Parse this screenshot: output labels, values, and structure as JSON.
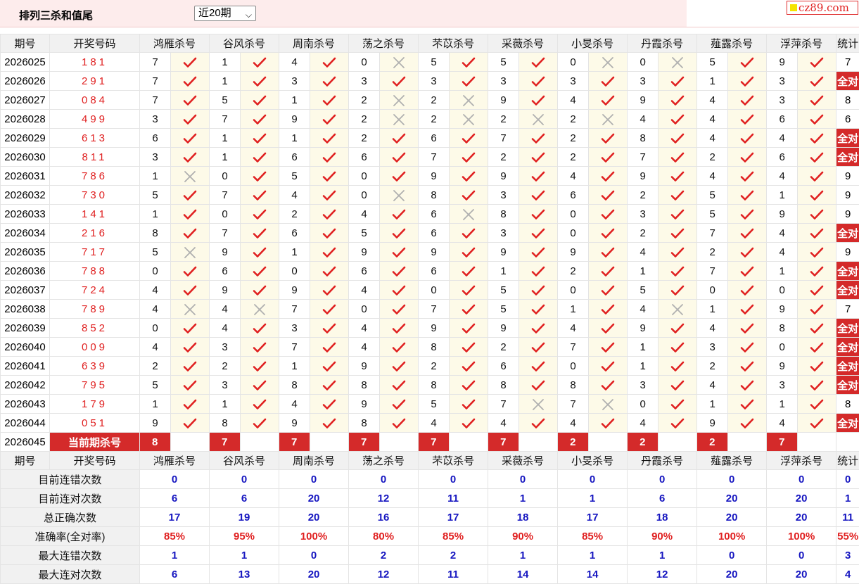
{
  "header": {
    "title": "排列三杀和值尾",
    "range_select": "近20期",
    "logo_text": "cz89.com"
  },
  "columns": {
    "period": "期号",
    "winning": "开奖号码",
    "experts": [
      "鸿雁杀号",
      "谷风杀号",
      "周南杀号",
      "荡之杀号",
      "芣苡杀号",
      "采薇杀号",
      "小旻杀号",
      "丹霞杀号",
      "薤露杀号",
      "浮萍杀号"
    ],
    "stat": "统计"
  },
  "rows": [
    {
      "period": "2026025",
      "number": "181",
      "picks": [
        7,
        1,
        4,
        0,
        5,
        5,
        0,
        0,
        5,
        9
      ],
      "hits": [
        1,
        1,
        1,
        0,
        1,
        1,
        0,
        0,
        1,
        1
      ],
      "stat": "7"
    },
    {
      "period": "2026026",
      "number": "291",
      "picks": [
        7,
        1,
        3,
        3,
        3,
        3,
        3,
        3,
        1,
        3
      ],
      "hits": [
        1,
        1,
        1,
        1,
        1,
        1,
        1,
        1,
        1,
        1
      ],
      "stat": "全对"
    },
    {
      "period": "2026027",
      "number": "084",
      "picks": [
        7,
        5,
        1,
        2,
        2,
        9,
        4,
        9,
        4,
        3
      ],
      "hits": [
        1,
        1,
        1,
        0,
        0,
        1,
        1,
        1,
        1,
        1
      ],
      "stat": "8"
    },
    {
      "period": "2026028",
      "number": "499",
      "picks": [
        3,
        7,
        9,
        2,
        2,
        2,
        2,
        4,
        4,
        6
      ],
      "hits": [
        1,
        1,
        1,
        0,
        0,
        0,
        0,
        1,
        1,
        1
      ],
      "stat": "6"
    },
    {
      "period": "2026029",
      "number": "613",
      "picks": [
        6,
        1,
        1,
        2,
        6,
        7,
        2,
        8,
        4,
        4
      ],
      "hits": [
        1,
        1,
        1,
        1,
        1,
        1,
        1,
        1,
        1,
        1
      ],
      "stat": "全对"
    },
    {
      "period": "2026030",
      "number": "811",
      "picks": [
        3,
        1,
        6,
        6,
        7,
        2,
        2,
        7,
        2,
        6
      ],
      "hits": [
        1,
        1,
        1,
        1,
        1,
        1,
        1,
        1,
        1,
        1
      ],
      "stat": "全对"
    },
    {
      "period": "2026031",
      "number": "786",
      "picks": [
        1,
        0,
        5,
        0,
        9,
        9,
        4,
        9,
        4,
        4
      ],
      "hits": [
        0,
        1,
        1,
        1,
        1,
        1,
        1,
        1,
        1,
        1
      ],
      "stat": "9"
    },
    {
      "period": "2026032",
      "number": "730",
      "picks": [
        5,
        7,
        4,
        0,
        8,
        3,
        6,
        2,
        5,
        1
      ],
      "hits": [
        1,
        1,
        1,
        0,
        1,
        1,
        1,
        1,
        1,
        1
      ],
      "stat": "9"
    },
    {
      "period": "2026033",
      "number": "141",
      "picks": [
        1,
        0,
        2,
        4,
        6,
        8,
        0,
        3,
        5,
        9
      ],
      "hits": [
        1,
        1,
        1,
        1,
        0,
        1,
        1,
        1,
        1,
        1
      ],
      "stat": "9"
    },
    {
      "period": "2026034",
      "number": "216",
      "picks": [
        8,
        7,
        6,
        5,
        6,
        3,
        0,
        2,
        7,
        4
      ],
      "hits": [
        1,
        1,
        1,
        1,
        1,
        1,
        1,
        1,
        1,
        1
      ],
      "stat": "全对"
    },
    {
      "period": "2026035",
      "number": "717",
      "picks": [
        5,
        9,
        1,
        9,
        9,
        9,
        9,
        4,
        2,
        4
      ],
      "hits": [
        0,
        1,
        1,
        1,
        1,
        1,
        1,
        1,
        1,
        1
      ],
      "stat": "9"
    },
    {
      "period": "2026036",
      "number": "788",
      "picks": [
        0,
        6,
        0,
        6,
        6,
        1,
        2,
        1,
        7,
        1
      ],
      "hits": [
        1,
        1,
        1,
        1,
        1,
        1,
        1,
        1,
        1,
        1
      ],
      "stat": "全对"
    },
    {
      "period": "2026037",
      "number": "724",
      "picks": [
        4,
        9,
        9,
        4,
        0,
        5,
        0,
        5,
        0,
        0
      ],
      "hits": [
        1,
        1,
        1,
        1,
        1,
        1,
        1,
        1,
        1,
        1
      ],
      "stat": "全对"
    },
    {
      "period": "2026038",
      "number": "789",
      "picks": [
        4,
        4,
        7,
        0,
        7,
        5,
        1,
        4,
        1,
        9
      ],
      "hits": [
        0,
        0,
        1,
        1,
        1,
        1,
        1,
        0,
        1,
        1
      ],
      "stat": "7"
    },
    {
      "period": "2026039",
      "number": "852",
      "picks": [
        0,
        4,
        3,
        4,
        9,
        9,
        4,
        9,
        4,
        8
      ],
      "hits": [
        1,
        1,
        1,
        1,
        1,
        1,
        1,
        1,
        1,
        1
      ],
      "stat": "全对"
    },
    {
      "period": "2026040",
      "number": "009",
      "picks": [
        4,
        3,
        7,
        4,
        8,
        2,
        7,
        1,
        3,
        0
      ],
      "hits": [
        1,
        1,
        1,
        1,
        1,
        1,
        1,
        1,
        1,
        1
      ],
      "stat": "全对"
    },
    {
      "period": "2026041",
      "number": "639",
      "picks": [
        2,
        2,
        1,
        9,
        2,
        6,
        0,
        1,
        2,
        9
      ],
      "hits": [
        1,
        1,
        1,
        1,
        1,
        1,
        1,
        1,
        1,
        1
      ],
      "stat": "全对"
    },
    {
      "period": "2026042",
      "number": "795",
      "picks": [
        5,
        3,
        8,
        8,
        8,
        8,
        8,
        3,
        4,
        3
      ],
      "hits": [
        1,
        1,
        1,
        1,
        1,
        1,
        1,
        1,
        1,
        1
      ],
      "stat": "全对"
    },
    {
      "period": "2026043",
      "number": "179",
      "picks": [
        1,
        1,
        4,
        9,
        5,
        7,
        7,
        0,
        1,
        1
      ],
      "hits": [
        1,
        1,
        1,
        1,
        1,
        0,
        0,
        1,
        1,
        1
      ],
      "stat": "8"
    },
    {
      "period": "2026044",
      "number": "051",
      "picks": [
        9,
        8,
        9,
        8,
        4,
        4,
        4,
        4,
        9,
        4
      ],
      "hits": [
        1,
        1,
        1,
        1,
        1,
        1,
        1,
        1,
        1,
        1
      ],
      "stat": "全对"
    }
  ],
  "current": {
    "period": "2026045",
    "label": "当前期杀号",
    "picks": [
      8,
      7,
      7,
      7,
      7,
      7,
      2,
      2,
      2,
      7
    ]
  },
  "stats": [
    {
      "label": "目前连错次数",
      "values": [
        "0",
        "0",
        "0",
        "0",
        "0",
        "0",
        "0",
        "0",
        "0",
        "0"
      ],
      "total": "0",
      "color": "blue"
    },
    {
      "label": "目前连对次数",
      "values": [
        "6",
        "6",
        "20",
        "12",
        "11",
        "1",
        "1",
        "6",
        "20",
        "20"
      ],
      "total": "1",
      "color": "blue"
    },
    {
      "label": "总正确次数",
      "values": [
        "17",
        "19",
        "20",
        "16",
        "17",
        "18",
        "17",
        "18",
        "20",
        "20"
      ],
      "total": "11",
      "color": "blue"
    },
    {
      "label": "准确率(全对率)",
      "values": [
        "85%",
        "95%",
        "100%",
        "80%",
        "85%",
        "90%",
        "85%",
        "90%",
        "100%",
        "100%"
      ],
      "total": "55%",
      "color": "red"
    },
    {
      "label": "最大连错次数",
      "values": [
        "1",
        "1",
        "0",
        "2",
        "2",
        "1",
        "1",
        "1",
        "0",
        "0"
      ],
      "total": "3",
      "color": "blue"
    },
    {
      "label": "最大连对次数",
      "values": [
        "6",
        "13",
        "20",
        "12",
        "11",
        "14",
        "14",
        "12",
        "20",
        "20"
      ],
      "total": "4",
      "color": "blue"
    }
  ],
  "colors": {
    "accent": "#d42a2a",
    "check": "#e02020",
    "cross": "#b0b0b0",
    "stat_blue": "#1515c0"
  }
}
